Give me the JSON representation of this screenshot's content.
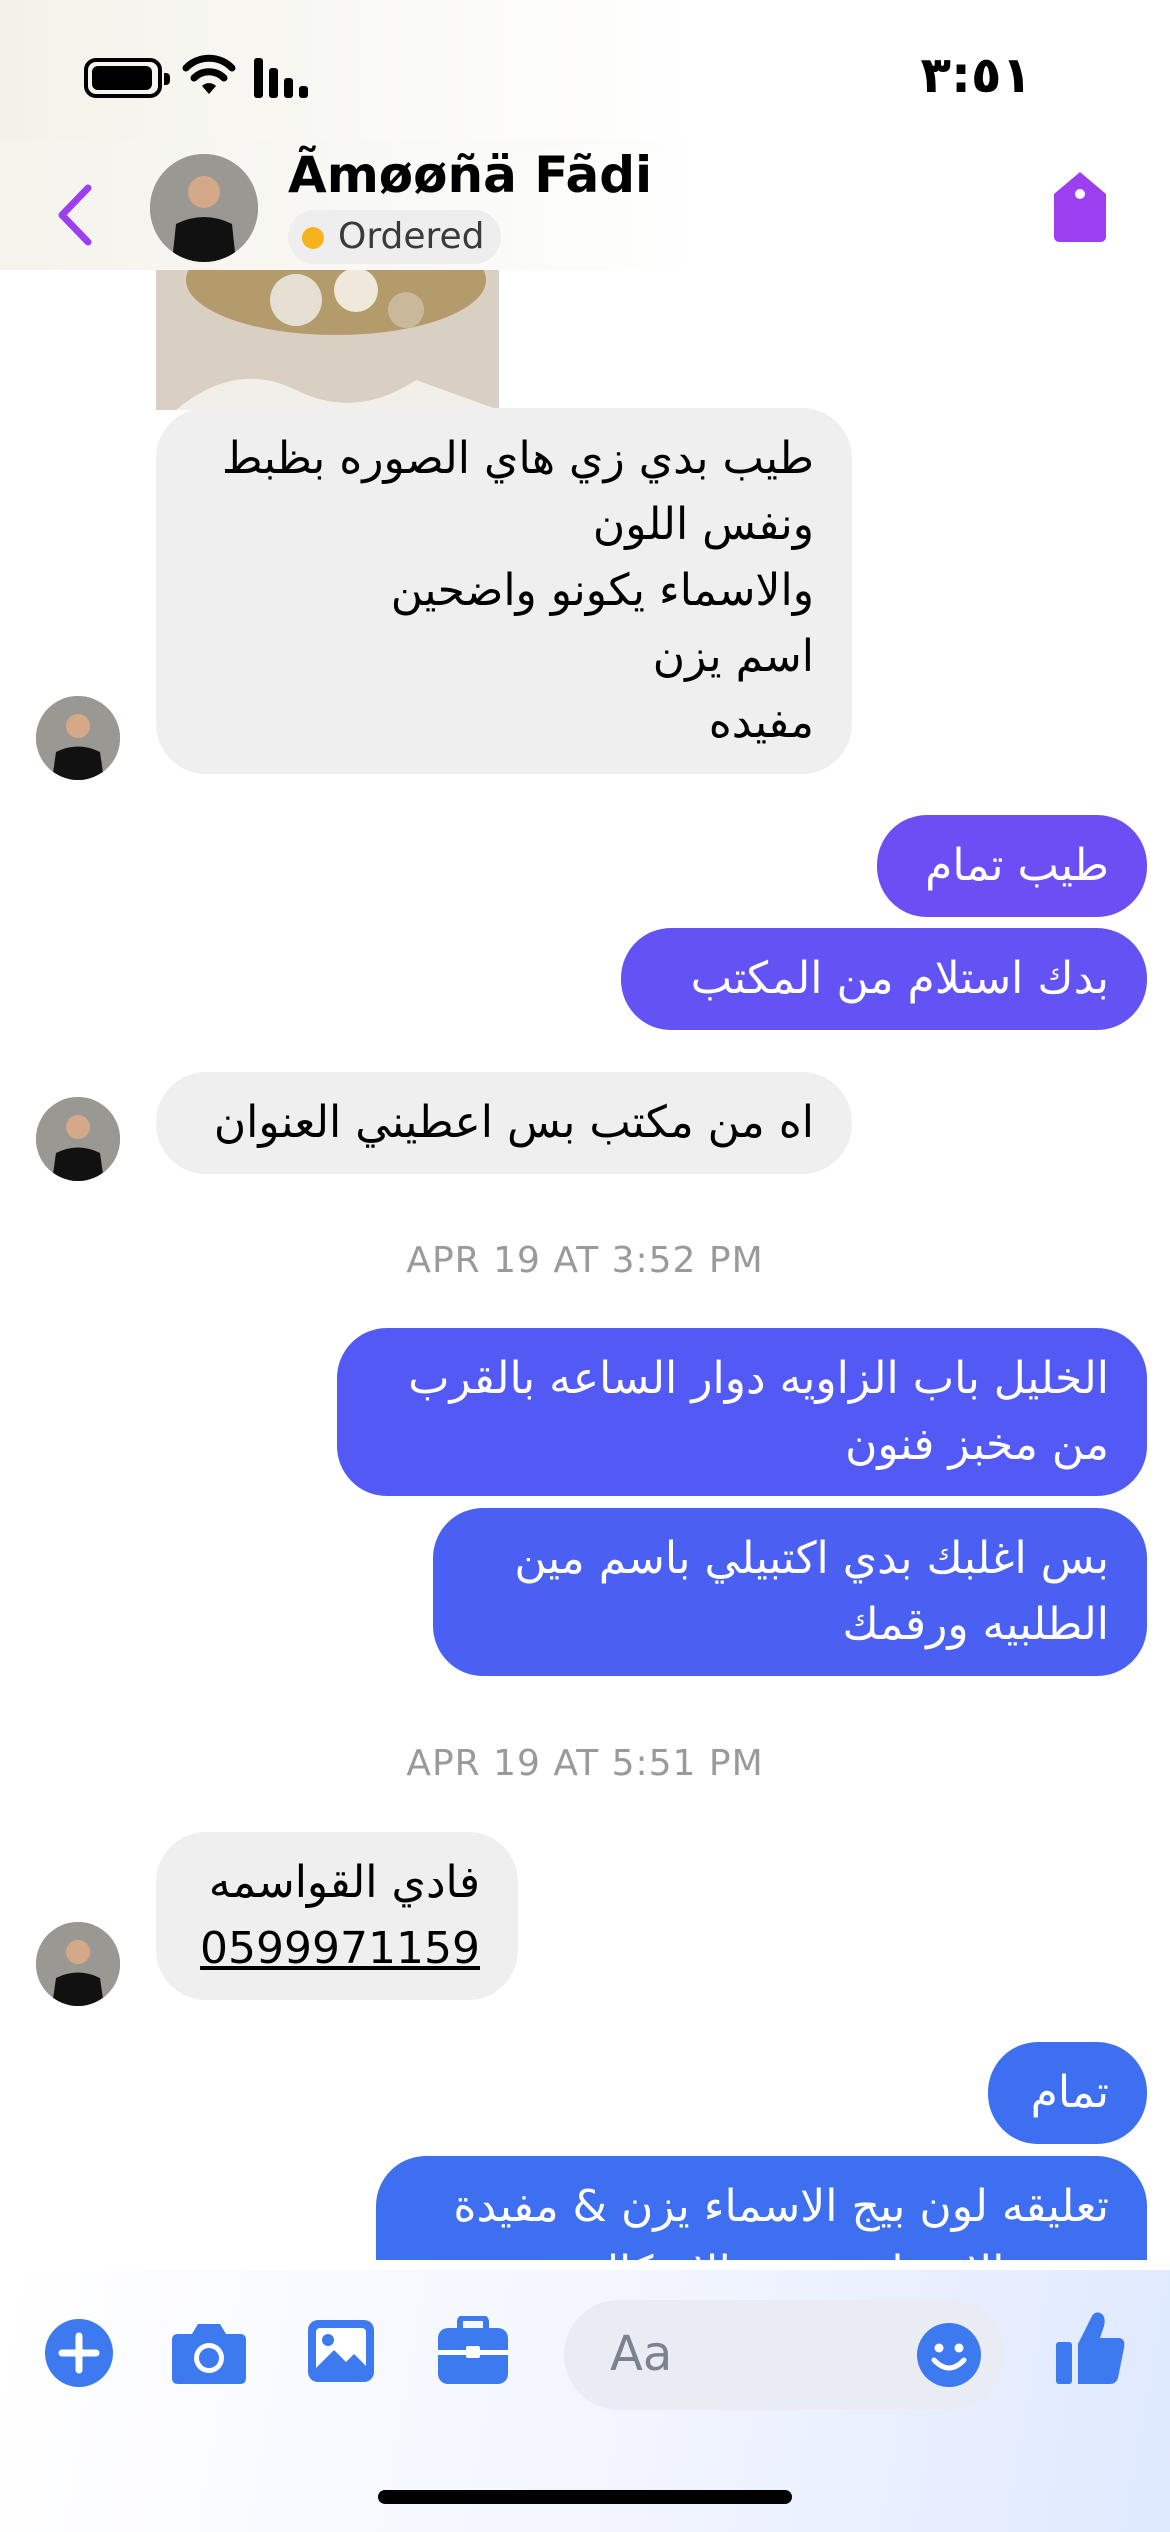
{
  "status_bar": {
    "time": "٣:٥١"
  },
  "header": {
    "contact_name": "Ãmøøñä Fãdi",
    "status_label": "Ordered"
  },
  "messages": [
    {
      "direction": "incoming",
      "lines": [
        "طيب بدي زي هاي الصوره بظبط",
        "ونفس اللون",
        "والاسماء يكونو واضحين",
        "اسم يزن",
        "مفيده"
      ]
    },
    {
      "direction": "outgoing",
      "lines": [
        "طيب تمام"
      ]
    },
    {
      "direction": "outgoing",
      "lines": [
        "بدك استلام من المكتب"
      ]
    },
    {
      "direction": "incoming",
      "lines": [
        "اه من مكتب بس اعطيني العنوان"
      ]
    },
    {
      "direction": "outgoing",
      "lines": [
        "الخليل باب الزاويه دوار الساعه بالقرب",
        "من مخبز فنون"
      ]
    },
    {
      "direction": "outgoing",
      "lines": [
        "بس اغلبك بدي اكتبيلي باسم مين",
        "الطلبيه ورقمك"
      ]
    },
    {
      "direction": "incoming",
      "lines": [
        "فادي القواسمه",
        "0599971159"
      ]
    },
    {
      "direction": "outgoing",
      "lines": [
        "تمام"
      ]
    },
    {
      "direction": "outgoing",
      "lines": [
        "تعليقه لون بيج الاسماء يزن & مفيدة",
        "نفس الاسماء ونفس الاشكال"
      ]
    }
  ],
  "timestamps": [
    "APR 19 AT 3:52 PM",
    "APR 19 AT 5:51 PM"
  ],
  "composer": {
    "placeholder": "Aa",
    "icons": [
      "plus-icon",
      "camera-icon",
      "gallery-icon",
      "briefcase-icon",
      "emoji-icon",
      "thumbs-up-icon"
    ]
  },
  "colors": {
    "accent_purple": "#9b3ff0",
    "bubble_purple": "#6d4ef5",
    "bubble_indigo": "#4f5cf3",
    "bubble_blue": "#3e6ff0",
    "incoming_bubble": "#efefef",
    "status_dot": "#f5b31e",
    "icon_blue": "#3d7af0"
  }
}
